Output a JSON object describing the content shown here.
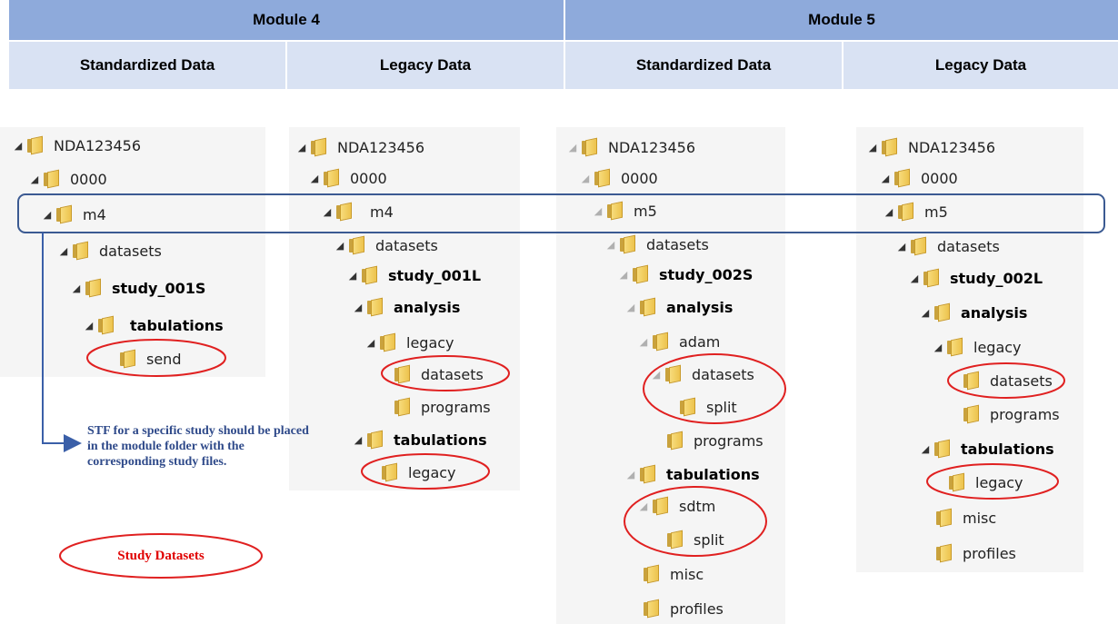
{
  "headers": {
    "module4": "Module 4",
    "module5": "Module 5",
    "m4_std": "Standardized Data",
    "m4_leg": "Legacy Data",
    "m5_std": "Standardized Data",
    "m5_leg": "Legacy Data"
  },
  "col1": {
    "nda": "NDA123456",
    "seq": "0000",
    "m": "m4",
    "datasets": "datasets",
    "study": "study_001S",
    "tab": "tabulations",
    "send": "send"
  },
  "col2": {
    "nda": "NDA123456",
    "seq": "0000",
    "m": "m4",
    "datasets": "datasets",
    "study": "study_001L",
    "analysis": "analysis",
    "legacy": "legacy",
    "ds": "datasets",
    "programs": "programs",
    "tab": "tabulations",
    "tlegacy": "legacy"
  },
  "col3": {
    "nda": "NDA123456",
    "seq": "0000",
    "m": "m5",
    "datasets": "datasets",
    "study": "study_002S",
    "analysis": "analysis",
    "adam": "adam",
    "ds": "datasets",
    "split": "split",
    "programs": "programs",
    "tab": "tabulations",
    "sdtm": "sdtm",
    "split2": "split",
    "misc": "misc",
    "profiles": "profiles"
  },
  "col4": {
    "nda": "NDA123456",
    "seq": "0000",
    "m": "m5",
    "datasets": "datasets",
    "study": "study_002L",
    "analysis": "analysis",
    "legacy": "legacy",
    "ds": "datasets",
    "programs": "programs",
    "tab": "tabulations",
    "tlegacy": "legacy",
    "misc": "misc",
    "profiles": "profiles"
  },
  "note": "STF for a specific study should be placed in the module folder with the corresponding study files.",
  "legend": "Study Datasets",
  "colors": {
    "module_header": "#8eaadb",
    "sub_header": "#d9e2f3",
    "highlight_box": "#3b5a92",
    "study_circle": "#e02020",
    "arrow": "#3a5fa8",
    "folder": "#edc34d"
  }
}
